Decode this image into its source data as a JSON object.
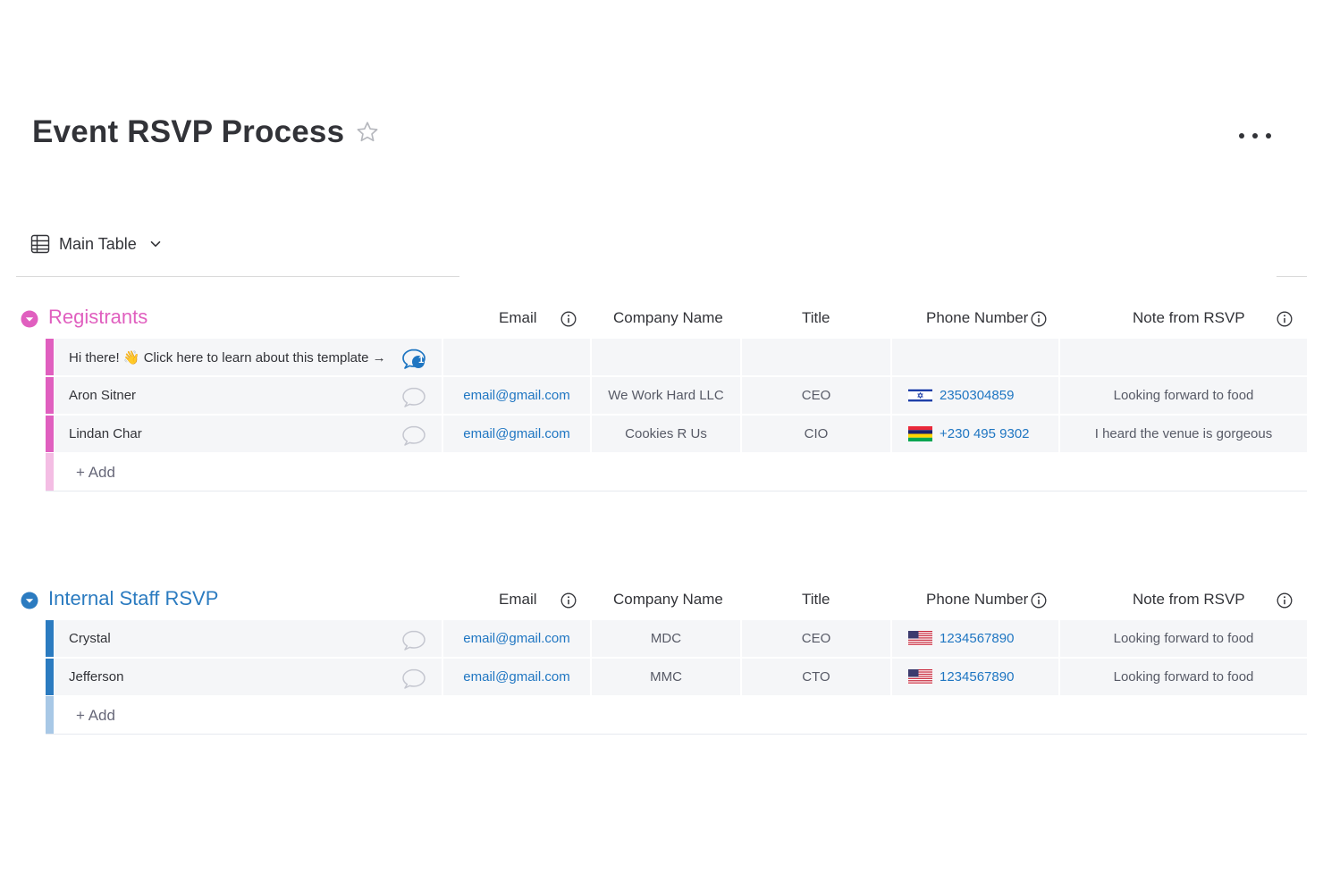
{
  "board": {
    "title": "Event RSVP Process",
    "view_label": "Main Table"
  },
  "colors": {
    "registrants": "#e05fbf",
    "registrants_light": "#f4bde4",
    "staff": "#2b7bc0",
    "staff_light": "#a8c8e6",
    "link": "#1f76c2",
    "title_text": "#323338"
  },
  "columns": {
    "email": "Email",
    "company": "Company Name",
    "title": "Title",
    "phone": "Phone Number",
    "note": "Note from RSVP"
  },
  "groups": [
    {
      "name": "Registrants",
      "add_label": "+ Add",
      "items": [
        {
          "name": "Hi there! 👋 Click here to learn about this template →",
          "updates_count": "1",
          "email": "",
          "company": "",
          "title": "",
          "phone": "",
          "flag": "",
          "note": ""
        },
        {
          "name": "Aron Sitner",
          "email": "email@gmail.com",
          "company": "We Work Hard LLC",
          "title": "CEO",
          "phone": "2350304859",
          "flag": "israel-flag-icon",
          "note": "Looking forward to food"
        },
        {
          "name": "Lindan Char",
          "email": "email@gmail.com",
          "company": "Cookies R Us",
          "title": "CIO",
          "phone": "+230 495 9302",
          "flag": "mauritius-flag-icon",
          "note": "I heard the venue is gorgeous"
        }
      ]
    },
    {
      "name": "Internal Staff RSVP",
      "add_label": "+ Add",
      "items": [
        {
          "name": "Crystal",
          "email": "email@gmail.com",
          "company": "MDC",
          "title": "CEO",
          "phone": "1234567890",
          "flag": "us-flag-icon",
          "note": "Looking forward to food"
        },
        {
          "name": "Jefferson",
          "email": "email@gmail.com",
          "company": "MMC",
          "title": "CTO",
          "phone": "1234567890",
          "flag": "us-flag-icon",
          "note": "Looking forward to food"
        }
      ]
    }
  ]
}
